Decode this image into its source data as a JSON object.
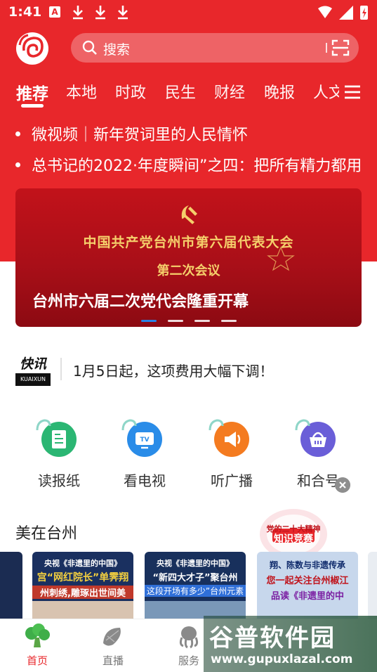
{
  "status_bar": {
    "time": "1:41",
    "a_badge": "A"
  },
  "search": {
    "placeholder": "搜索"
  },
  "tabs": [
    "推荐",
    "本地",
    "时政",
    "民生",
    "财经",
    "晚报",
    "人文"
  ],
  "headlines": [
    "微视频｜新年贺词里的人民情怀",
    "总书记的2022·年度瞬间”之四：把所有精力都用"
  ],
  "banner": {
    "line1": "中国共产党台州市第六届代表大会",
    "line2": "第二次会议",
    "title": "台州市六届二次党代会隆重开幕",
    "active_dot": 0,
    "dot_count": 4
  },
  "kuaixun": {
    "logo_big": "快讯",
    "logo_small": "KUAIXUN",
    "text": "1月5日起，这项费用大幅下调！"
  },
  "quick_icons": [
    {
      "label": "读报纸",
      "icon": "newspaper-icon",
      "color": "#2bb673",
      "glyph": "N"
    },
    {
      "label": "看电视",
      "icon": "tv-icon",
      "color": "#2a8ce8",
      "glyph": "TV"
    },
    {
      "label": "听广播",
      "icon": "radio-icon",
      "color": "#f47b20",
      "glyph": "◀"
    },
    {
      "label": "和合号",
      "icon": "basket-icon",
      "color": "#6a5ed8",
      "glyph": "☐"
    }
  ],
  "section": {
    "title": "美在台州",
    "quiz_line1": "党的二十大精神",
    "quiz_line2": "知识竞赛"
  },
  "cards": [
    {
      "top": "央视《非遗里的中国》",
      "mid": "宫“网红院长”单霁翔",
      "bottom": "州刺绣,雕琢出世间美"
    },
    {
      "top": "央视《非遗里的中国》",
      "mid": "“新四大才子”聚台州",
      "bottom": "这段开场有多少”台州元素"
    },
    {
      "top": "翔、陈数与非遗传承",
      "mid": "您一起关注台州椒江",
      "bottom": "品读《非遗里的中"
    }
  ],
  "bottom_nav": [
    {
      "label": "首页",
      "icon": "broccoli-icon",
      "active": true
    },
    {
      "label": "直播",
      "icon": "fish-icon",
      "active": false
    },
    {
      "label": "服务",
      "icon": "octopus-icon",
      "active": false
    }
  ],
  "watermark": {
    "big": "谷普软件园",
    "small": "www.gupuxlazal.com"
  },
  "colors": {
    "brand_red": "#e8272b",
    "gold": "#f5cf6b",
    "dot_active": "#2a82e4"
  }
}
